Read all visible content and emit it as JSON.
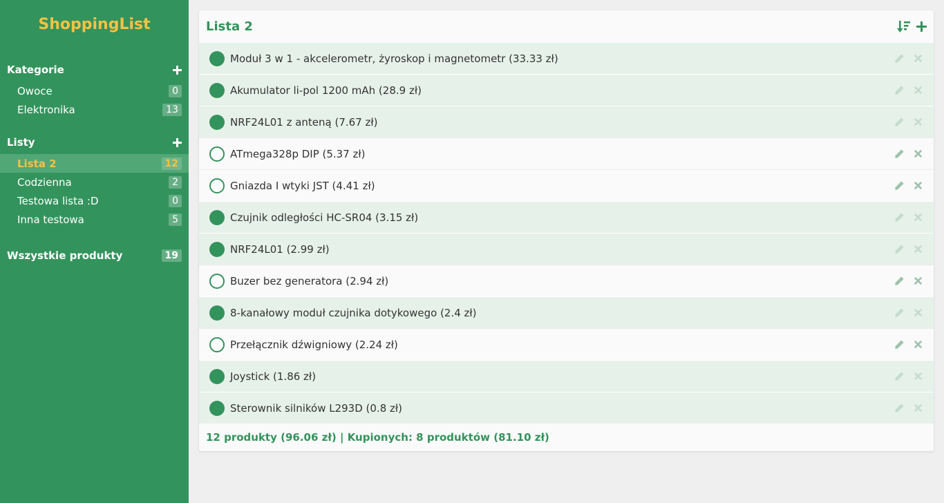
{
  "app": {
    "title": "ShoppingList"
  },
  "sidebar": {
    "categories": {
      "label": "Kategorie",
      "items": [
        {
          "label": "Owoce",
          "count": "0"
        },
        {
          "label": "Elektronika",
          "count": "13"
        }
      ]
    },
    "lists": {
      "label": "Listy",
      "items": [
        {
          "label": "Lista 2",
          "count": "12",
          "active": true
        },
        {
          "label": "Codzienna",
          "count": "2"
        },
        {
          "label": "Testowa lista :D",
          "count": "0"
        },
        {
          "label": "Inna testowa",
          "count": "5"
        }
      ]
    },
    "all_products": {
      "label": "Wszystkie produkty",
      "count": "19"
    }
  },
  "main": {
    "title": "Lista 2",
    "items": [
      {
        "name": "Moduł 3 w 1 - akcelerometr, żyroskop i magnetometr (33.33 zł)",
        "bought": true
      },
      {
        "name": "Akumulator li-pol 1200 mAh (28.9 zł)",
        "bought": true
      },
      {
        "name": "NRF24L01 z anteną (7.67 zł)",
        "bought": true
      },
      {
        "name": "ATmega328p DIP (5.37 zł)",
        "bought": false
      },
      {
        "name": "Gniazda I wtyki JST (4.41 zł)",
        "bought": false
      },
      {
        "name": "Czujnik odległości HC-SR04 (3.15 zł)",
        "bought": true
      },
      {
        "name": "NRF24L01 (2.99 zł)",
        "bought": true
      },
      {
        "name": "Buzer bez generatora (2.94 zł)",
        "bought": false
      },
      {
        "name": "8-kanałowy moduł czujnika dotykowego (2.4 zł)",
        "bought": true
      },
      {
        "name": "Przełącznik dźwigniowy (2.24 zł)",
        "bought": false
      },
      {
        "name": "Joystick (1.86 zł)",
        "bought": true
      },
      {
        "name": "Sterownik silników L293D (0.8 zł)",
        "bought": true
      }
    ],
    "summary": "12 produkty (96.06 zł) | Kupionych: 8 produktów (81.10 zł)"
  },
  "colors": {
    "accent": "#33935c",
    "brand": "#f6c244",
    "bought_row": "#e6f1ea"
  }
}
